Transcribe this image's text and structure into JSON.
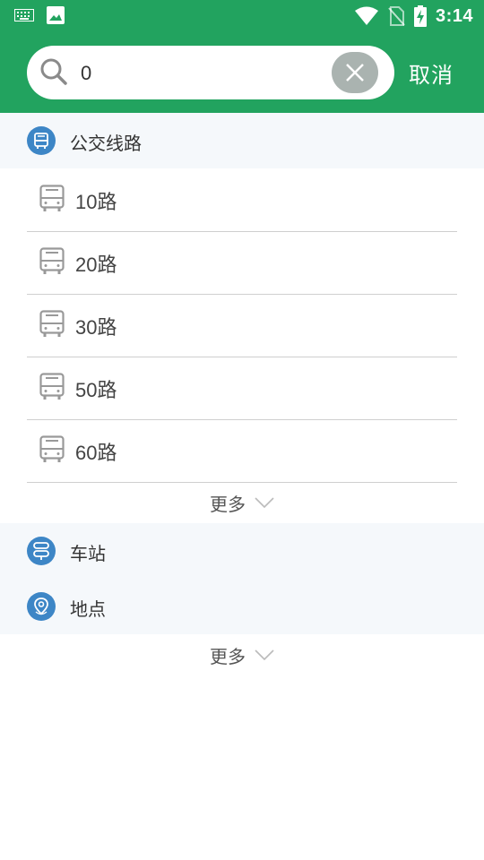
{
  "status_bar": {
    "time": "3:14",
    "icons_left": [
      "keyboard-icon",
      "image-icon"
    ],
    "icons_right": [
      "wifi-icon",
      "no-sim-icon",
      "battery-charging-icon"
    ]
  },
  "search": {
    "value": "0",
    "clear_icon": "clear-icon",
    "cancel_label": "取消"
  },
  "sections": {
    "bus_routes": {
      "label": "公交线路",
      "items": [
        {
          "label": "10路"
        },
        {
          "label": "20路"
        },
        {
          "label": "30路"
        },
        {
          "label": "50路"
        },
        {
          "label": "60路"
        }
      ],
      "more_label": "更多"
    },
    "stations": {
      "label": "车站"
    },
    "places": {
      "label": "地点"
    },
    "bottom_more_label": "更多"
  },
  "colors": {
    "brand_green": "#22a35f",
    "section_icon_blue": "#3d86c6",
    "section_bg": "#f5f8fb"
  }
}
